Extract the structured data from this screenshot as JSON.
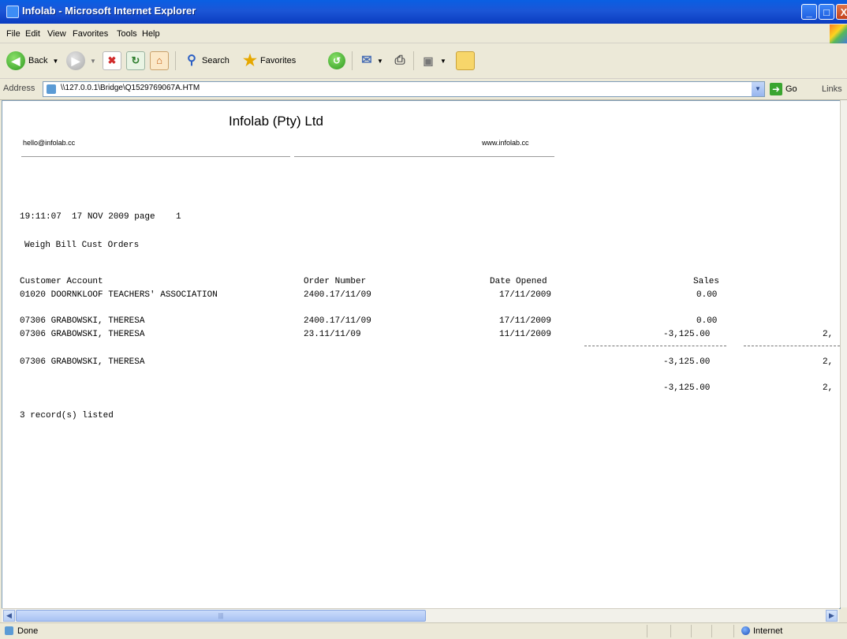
{
  "window": {
    "title": "Infolab - Microsoft Internet Explorer",
    "controls": {
      "minimize": "_",
      "maximize": "□",
      "close": "X"
    }
  },
  "menu": [
    "File",
    "Edit",
    "View",
    "Favorites",
    "Tools",
    "Help"
  ],
  "toolbar": {
    "back": "Back",
    "search": "Search",
    "favorites": "Favorites",
    "icons": [
      "back-icon",
      "forward-icon",
      "stop-icon",
      "refresh-icon",
      "home-icon",
      "search-icon",
      "favorites-icon",
      "history-icon",
      "mail-icon",
      "print-icon",
      "edit-icon",
      "folder-icon"
    ]
  },
  "address": {
    "label": "Address",
    "url": "\\\\127.0.0.1\\Bridge\\Q1529769067A.HTM",
    "go": "Go",
    "links": "Links"
  },
  "report": {
    "company": "Infolab (Pty) Ltd",
    "email": "hello@infolab.cc",
    "website": "www.infolab.cc",
    "timestamp_line": "19:11:07  17 NOV 2009 page    1",
    "report_title": "Weigh Bill Cust Orders",
    "columns": [
      "Customer Account",
      "Order Number",
      "Date Opened",
      "Sales"
    ],
    "rows": [
      {
        "account": "01020 DOORNKLOOF TEACHERS' ASSOCIATION",
        "order": "2400.17/11/09",
        "date": "17/11/2009",
        "sales": "0.00"
      },
      {
        "account": "07306 GRABOWSKI, THERESA",
        "order": "2400.17/11/09",
        "date": "17/11/2009",
        "sales": "0.00"
      },
      {
        "account": "07306 GRABOWSKI, THERESA",
        "order": "23.11/11/09",
        "date": "11/11/2009",
        "sales": "-3,125.00",
        "extra": "2,"
      }
    ],
    "subtotal": {
      "account": "07306 GRABOWSKI, THERESA",
      "sales": "-3,125.00",
      "extra": "2,"
    },
    "grand_total": {
      "sales": "-3,125.00",
      "extra": "2,"
    },
    "footer": "3 record(s) listed"
  },
  "status": {
    "text": "Done",
    "zone": "Internet"
  },
  "colors": {
    "titlebar": "#0a5fe3",
    "chrome": "#ece9d8",
    "page": "#ffffff"
  }
}
